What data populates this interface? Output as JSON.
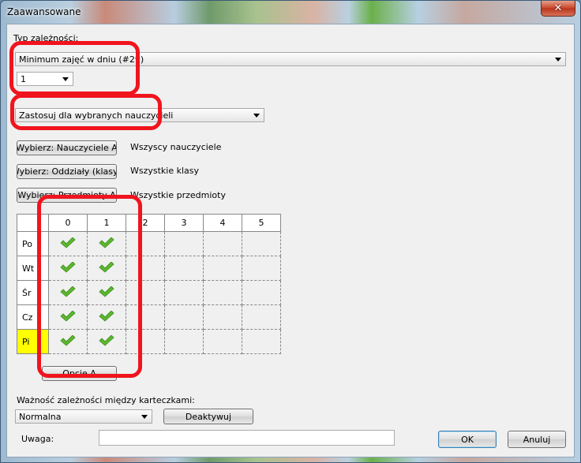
{
  "window": {
    "title": "Zaawansowane",
    "close_icon": "close-icon"
  },
  "dependency": {
    "label": "Typ zależności:",
    "type_value": "Minimum zajęć w dniu (#29)",
    "count_value": "1"
  },
  "apply_scope": {
    "value": "Zastosuj dla wybranych nauczycieli"
  },
  "selectors": [
    {
      "button": "Wybierz: Nauczyciele A",
      "text": "Wszyscy nauczyciele"
    },
    {
      "button": "Wybierz: Oddziały (klasy) A",
      "text": "Wszystkie klasy"
    },
    {
      "button": "Wybierz: Przedmioty A",
      "text": "Wszystkie przedmioty"
    }
  ],
  "grid": {
    "columns": [
      "0",
      "1",
      "2",
      "3",
      "4",
      "5"
    ],
    "highlighted_column": "5",
    "rows": [
      {
        "label": "Po",
        "checked": [
          true,
          true,
          false,
          false,
          false,
          false
        ]
      },
      {
        "label": "Wt",
        "checked": [
          true,
          true,
          false,
          false,
          false,
          false
        ]
      },
      {
        "label": "Śr",
        "checked": [
          true,
          true,
          false,
          false,
          false,
          false
        ]
      },
      {
        "label": "Cz",
        "checked": [
          true,
          true,
          false,
          false,
          false,
          false
        ]
      },
      {
        "label": "Pi",
        "checked": [
          true,
          true,
          false,
          false,
          false,
          false
        ],
        "highlighted": true
      }
    ],
    "check_icon": "check-icon",
    "check_color": "#5cb82e"
  },
  "options_button": "Opcje A",
  "importance": {
    "label": "Ważność zależności między karteczkami:",
    "value": "Normalna",
    "deactivate_button": "Deaktywuj"
  },
  "note": {
    "label": "Uwaga:",
    "value": ""
  },
  "buttons": {
    "ok": "OK",
    "cancel": "Anuluj"
  },
  "colors": {
    "annotation_red": "#f0141e",
    "highlight_yellow": "#ffff00"
  }
}
